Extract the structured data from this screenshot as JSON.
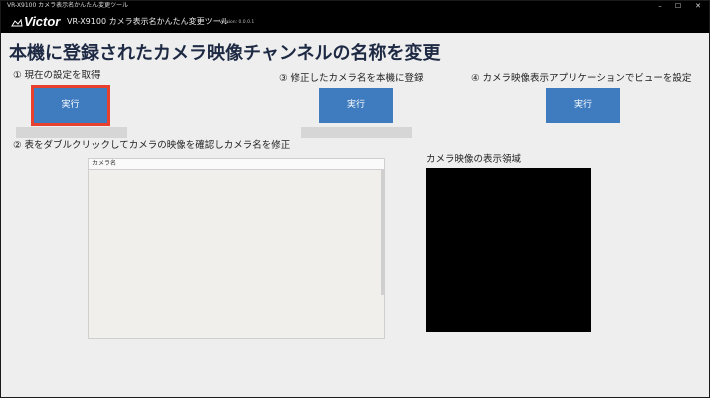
{
  "window": {
    "title": "VR-X9100 カメラ表示名かんたん変更ツール",
    "controls": [
      "–",
      "☐",
      "✕"
    ]
  },
  "header": {
    "brand": "Victor",
    "app_title": "VR-X9100 カメラ表示名かんたん変更ツール",
    "version": "Version: 0.0.0.1"
  },
  "main": {
    "title": "本機に登録されたカメラ映像チャンネルの名称を変更",
    "steps": [
      {
        "label": "① 現在の設定を取得",
        "button": "実行"
      },
      {
        "label": "② 表をダブルクリックしてカメラの映像を確認しカメラ名を修正"
      },
      {
        "label": "③ 修正したカメラ名を本機に登録",
        "button": "実行"
      },
      {
        "label": "④ カメラ映像表示アプリケーションでビューを設定",
        "button": "実行"
      }
    ],
    "table": {
      "column_header": "カメラ名"
    },
    "preview": {
      "label": "カメラ映像の表示領域"
    }
  },
  "colors": {
    "button": "#3e7bbf",
    "highlight": "#e8402f",
    "header_bg": "#000000",
    "panel_bg": "#eeeeee"
  }
}
